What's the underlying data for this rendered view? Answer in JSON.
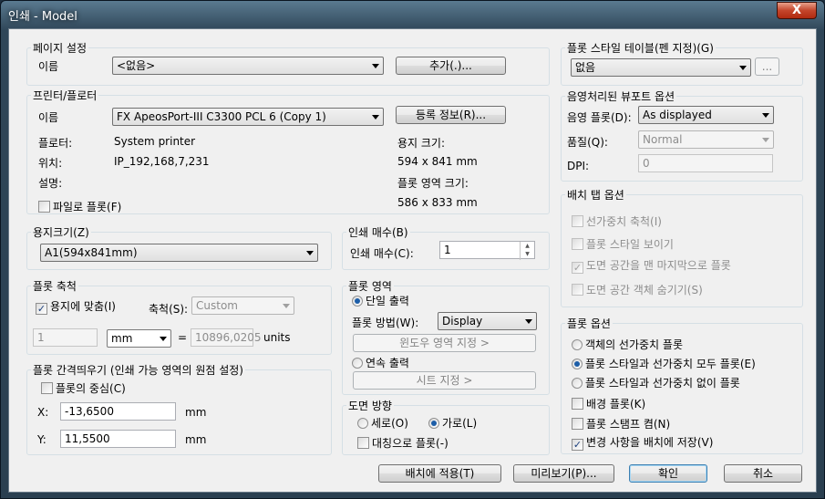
{
  "window": {
    "title": "인쇄 - Model",
    "close": "X"
  },
  "page_setup": {
    "group": "페이지 설정",
    "name_label": "이름",
    "name_value": "<없음>",
    "add_button": "추가(.)..."
  },
  "printer": {
    "group": "프린터/플로터",
    "name_label": "이름",
    "name_value": "FX ApeosPort-III C3300 PCL 6 (Copy 1)",
    "properties_button": "등록 정보(R)...",
    "plotter_label": "플로터:",
    "plotter_value": "System printer",
    "location_label": "위치:",
    "location_value": "IP_192,168,7,231",
    "desc_label": "설명:",
    "paper_size_label": "용지 크기:",
    "paper_size_value": "594 x 841 mm",
    "plot_area_label": "플롯 영역 크기:",
    "plot_area_value": "586 x 833 mm",
    "plot_to_file": "파일로 플롯(F)"
  },
  "paper_size": {
    "group": "용지크기(Z)",
    "value": "A1(594x841mm)"
  },
  "copies": {
    "group": "인쇄 매수(B)",
    "label": "인쇄 매수(C):",
    "value": "1"
  },
  "plot_scale": {
    "group": "플롯 축척",
    "fit_label": "용지에 맞춤(I)",
    "scale_label": "축척(S):",
    "scale_value": "Custom",
    "num_value": "1",
    "unit_value": "mm",
    "equals": "=",
    "den_value": "10896,0205",
    "units_label": "units"
  },
  "plot_area": {
    "group": "플롯 영역",
    "single": "단일 출력",
    "method_label": "플롯 방법(W):",
    "method_value": "Display",
    "window_button": "윈도우 영역 지정 >",
    "continuous": "연속 출력",
    "sheet_button": "시트 지정 >"
  },
  "plot_offset": {
    "group": "플롯 간격띄우기 (인쇄 가능 영역의 원점 설정)",
    "center_label": "플롯의 중심(C)",
    "x_label": "X:",
    "x_value": "-13,6500",
    "x_unit": "mm",
    "y_label": "Y:",
    "y_value": "11,5500",
    "y_unit": "mm"
  },
  "orientation": {
    "group": "도면 방향",
    "portrait": "세로(O)",
    "landscape": "가로(L)",
    "reverse": "대칭으로 플롯(-)"
  },
  "style_table": {
    "group": "플롯 스타일 테이블(펜 지정)(G)",
    "value": "없음",
    "edit_button": "..."
  },
  "shaded": {
    "group": "음영처리된 뷰포트 옵션",
    "shade_label": "음영 플롯(D):",
    "shade_value": "As displayed",
    "quality_label": "품질(Q):",
    "quality_value": "Normal",
    "dpi_label": "DPI:",
    "dpi_value": "0"
  },
  "layout_tab": {
    "group": "배치 탭 옵션",
    "items": [
      "선가중치 축척(I)",
      "플롯 스타일 보이기",
      "도면 공간을 맨 마지막으로 플롯",
      "도면 공간 객체 숨기기(S)"
    ]
  },
  "plot_options": {
    "group": "플롯 옵션",
    "radios": [
      "객체의 선가중치 플롯",
      "플롯 스타일과 선가중치 모두 플롯(E)",
      "플롯 스타일과 선가중치 없이 플롯"
    ],
    "checks": [
      "배경 플롯(K)",
      "플롯 스탬프 켬(N)",
      "변경 사항을 배치에 저장(V)"
    ]
  },
  "buttons": {
    "apply": "배치에 적용(T)",
    "preview": "미리보기(P)...",
    "ok": "확인",
    "cancel": "취소"
  }
}
